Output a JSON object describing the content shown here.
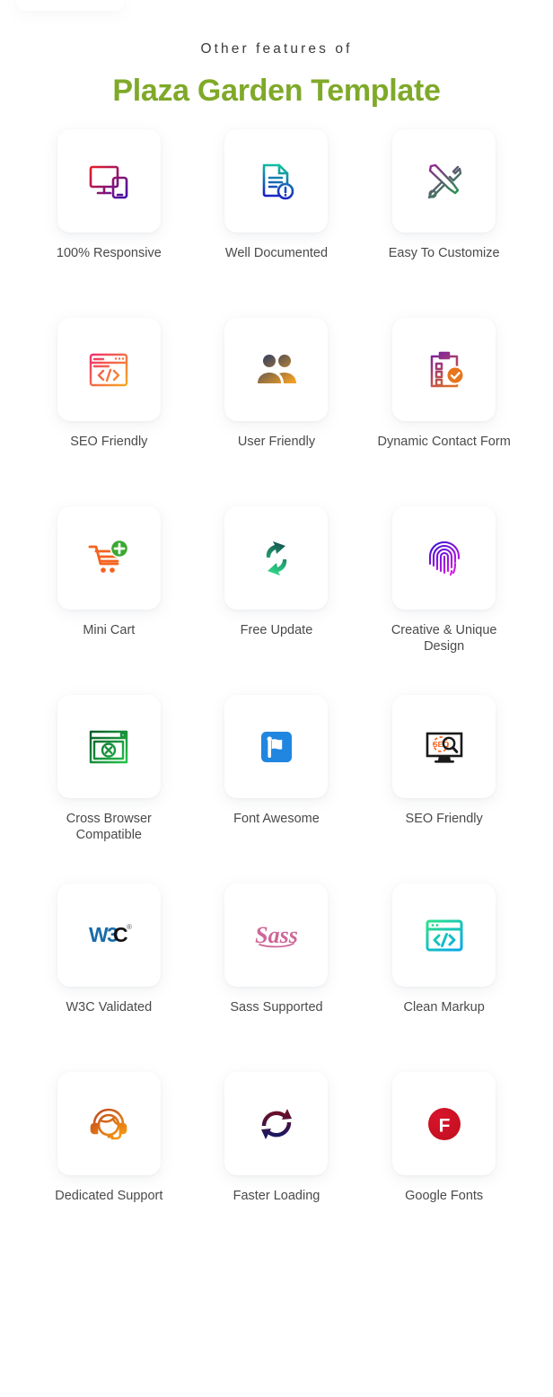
{
  "header": {
    "subtitle": "Other features of",
    "title": "Plaza Garden Template"
  },
  "colors": {
    "title_green": "#7FA929",
    "label_gray": "#4a4a4a",
    "subtitle_gray": "#3c3c3c",
    "card_bg": "#ffffff",
    "page_bg": "#ffffff"
  },
  "features": [
    {
      "label": "100% Responsive",
      "icon": "responsive-devices-icon",
      "colors": [
        "#ED1C24",
        "#3B0FB0"
      ]
    },
    {
      "label": "Well Documented",
      "icon": "document-alert-icon",
      "colors": [
        "#12C99B",
        "#1A12C9"
      ]
    },
    {
      "label": "Easy To Customize",
      "icon": "wrench-screwdriver-icon",
      "colors": [
        "#8E2C8E",
        "#1E9E4A"
      ]
    },
    {
      "label": "SEO Friendly",
      "icon": "browser-code-seo-icon",
      "colors": [
        "#F0326E",
        "#F5A623"
      ]
    },
    {
      "label": "User Friendly",
      "icon": "two-users-icon",
      "colors": [
        "#34405E",
        "#F2A024"
      ]
    },
    {
      "label": "Dynamic Contact Form",
      "icon": "clipboard-check-icon",
      "colors": [
        "#7B1FA2",
        "#E8741C"
      ]
    },
    {
      "label": "Mini Cart",
      "icon": "shopping-cart-plus-icon",
      "colors": [
        "#F4631E",
        "#3CA832"
      ]
    },
    {
      "label": "Free Update",
      "icon": "refresh-arrows-icon",
      "colors": [
        "#14504F",
        "#2FE08A"
      ]
    },
    {
      "label": "Creative & Unique Design",
      "icon": "fingerprint-icon",
      "colors": [
        "#3B0FD8",
        "#E21AE2"
      ]
    },
    {
      "label": "Cross Browser Compatible",
      "icon": "browser-cross-icon",
      "colors": [
        "#0B5D2A",
        "#25C14A"
      ]
    },
    {
      "label": "Font Awesome",
      "icon": "flag-icon",
      "colors": [
        "#2086E0",
        "#2086E0"
      ]
    },
    {
      "label": "SEO Friendly",
      "icon": "monitor-seo-search-icon",
      "colors": [
        "#1A1A1A",
        "#F4631E"
      ]
    },
    {
      "label": "W3C Validated",
      "icon": "w3c-logo-icon",
      "colors": [
        "#1A6CA8",
        "#111111"
      ]
    },
    {
      "label": "Sass Supported",
      "icon": "sass-logo-icon",
      "colors": [
        "#CD6799",
        "#CD6799"
      ]
    },
    {
      "label": "Clean Markup",
      "icon": "browser-code-icon",
      "colors": [
        "#2BE08C",
        "#06A8E8"
      ]
    },
    {
      "label": "Dedicated Support",
      "icon": "headset-support-icon",
      "colors": [
        "#C0451C",
        "#F79B12"
      ]
    },
    {
      "label": "Faster Loading",
      "icon": "sync-circle-icon",
      "colors": [
        "#7A0B1E",
        "#0B1A6B"
      ]
    },
    {
      "label": "Google Fonts",
      "icon": "google-fonts-f-icon",
      "colors": [
        "#D8142C",
        "#C2101F"
      ]
    }
  ]
}
